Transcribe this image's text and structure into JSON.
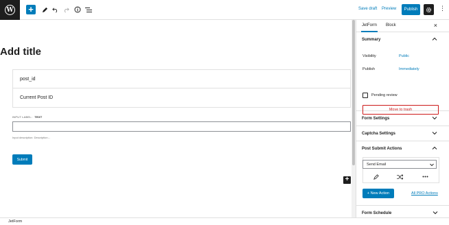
{
  "toolbar": {
    "save_draft": "Save draft",
    "preview": "Preview",
    "publish": "Publish"
  },
  "editor": {
    "title_placeholder": "Add title",
    "hidden_field": {
      "name": "post_id",
      "value": "Current Post ID"
    },
    "input_label_prefix": "INPUT LABEL:",
    "input_label_value": "TEXT",
    "input_description": "Input description:  Description...",
    "submit_label": "Submit"
  },
  "sidebar": {
    "tabs": [
      {
        "label": "JetForm",
        "active": true
      },
      {
        "label": "Block",
        "active": false
      }
    ],
    "close": "×",
    "summary": {
      "title": "Summary",
      "visibility_label": "Visibility",
      "visibility_value": "Public",
      "publish_label": "Publish",
      "publish_value": "Immediately",
      "pending_review": "Pending review",
      "move_to_trash": "Move to trash"
    },
    "form_settings": "Form Settings",
    "captcha_settings": "Captcha Settings",
    "post_submit": {
      "title": "Post Submit Actions",
      "selected_action": "Send Email",
      "new_action": "+ New Action",
      "pro_actions": "All PRO Actions"
    },
    "form_schedule": "Form Schedule"
  },
  "footer": {
    "breadcrumb": "JetForm"
  },
  "colors": {
    "accent": "#007cba",
    "danger": "#cc1818",
    "dark": "#1e1e1e"
  }
}
